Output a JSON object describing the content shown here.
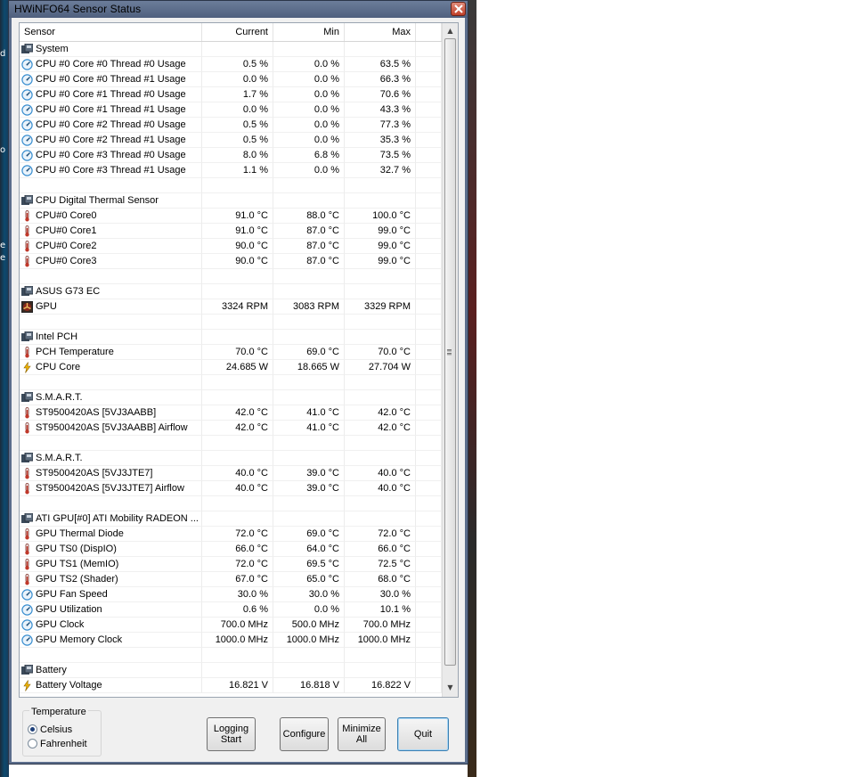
{
  "window": {
    "title": "HWiNFO64 Sensor Status"
  },
  "desktop_glyphs": [
    "d",
    "o",
    "e",
    "e"
  ],
  "columns": {
    "sensor": "Sensor",
    "current": "Current",
    "min": "Min",
    "max": "Max"
  },
  "rows": [
    {
      "kind": "group",
      "name": "System"
    },
    {
      "kind": "sensor",
      "icon": "gauge",
      "name": "CPU #0 Core #0 Thread #0 Usage",
      "current": "0.5 %",
      "min": "0.0 %",
      "max": "63.5 %"
    },
    {
      "kind": "sensor",
      "icon": "gauge",
      "name": "CPU #0 Core #0 Thread #1 Usage",
      "current": "0.0 %",
      "min": "0.0 %",
      "max": "66.3 %"
    },
    {
      "kind": "sensor",
      "icon": "gauge",
      "name": "CPU #0 Core #1 Thread #0 Usage",
      "current": "1.7 %",
      "min": "0.0 %",
      "max": "70.6 %"
    },
    {
      "kind": "sensor",
      "icon": "gauge",
      "name": "CPU #0 Core #1 Thread #1 Usage",
      "current": "0.0 %",
      "min": "0.0 %",
      "max": "43.3 %"
    },
    {
      "kind": "sensor",
      "icon": "gauge",
      "name": "CPU #0 Core #2 Thread #0 Usage",
      "current": "0.5 %",
      "min": "0.0 %",
      "max": "77.3 %"
    },
    {
      "kind": "sensor",
      "icon": "gauge",
      "name": "CPU #0 Core #2 Thread #1 Usage",
      "current": "0.5 %",
      "min": "0.0 %",
      "max": "35.3 %"
    },
    {
      "kind": "sensor",
      "icon": "gauge",
      "name": "CPU #0 Core #3 Thread #0 Usage",
      "current": "8.0 %",
      "min": "6.8 %",
      "max": "73.5 %"
    },
    {
      "kind": "sensor",
      "icon": "gauge",
      "name": "CPU #0 Core #3 Thread #1 Usage",
      "current": "1.1 %",
      "min": "0.0 %",
      "max": "32.7 %"
    },
    {
      "kind": "blank"
    },
    {
      "kind": "group",
      "name": "CPU Digital Thermal Sensor"
    },
    {
      "kind": "sensor",
      "icon": "thermometer",
      "name": "CPU#0 Core0",
      "current": "91.0 °C",
      "min": "88.0 °C",
      "max": "100.0 °C"
    },
    {
      "kind": "sensor",
      "icon": "thermometer",
      "name": "CPU#0 Core1",
      "current": "91.0 °C",
      "min": "87.0 °C",
      "max": "99.0 °C"
    },
    {
      "kind": "sensor",
      "icon": "thermometer",
      "name": "CPU#0 Core2",
      "current": "90.0 °C",
      "min": "87.0 °C",
      "max": "99.0 °C"
    },
    {
      "kind": "sensor",
      "icon": "thermometer",
      "name": "CPU#0 Core3",
      "current": "90.0 °C",
      "min": "87.0 °C",
      "max": "99.0 °C"
    },
    {
      "kind": "blank"
    },
    {
      "kind": "group",
      "name": "ASUS G73 EC"
    },
    {
      "kind": "sensor",
      "icon": "fan",
      "name": "GPU",
      "current": "3324 RPM",
      "min": "3083 RPM",
      "max": "3329 RPM"
    },
    {
      "kind": "blank"
    },
    {
      "kind": "group",
      "name": "Intel PCH"
    },
    {
      "kind": "sensor",
      "icon": "thermometer",
      "name": "PCH Temperature",
      "current": "70.0 °C",
      "min": "69.0 °C",
      "max": "70.0 °C"
    },
    {
      "kind": "sensor",
      "icon": "bolt",
      "name": "CPU Core",
      "current": "24.685 W",
      "min": "18.665 W",
      "max": "27.704 W"
    },
    {
      "kind": "blank"
    },
    {
      "kind": "group",
      "name": "S.M.A.R.T."
    },
    {
      "kind": "sensor",
      "icon": "thermometer",
      "name": "ST9500420AS [5VJ3AABB]",
      "current": "42.0 °C",
      "min": "41.0 °C",
      "max": "42.0 °C"
    },
    {
      "kind": "sensor",
      "icon": "thermometer",
      "name": "ST9500420AS [5VJ3AABB] Airflow",
      "current": "42.0 °C",
      "min": "41.0 °C",
      "max": "42.0 °C"
    },
    {
      "kind": "blank"
    },
    {
      "kind": "group",
      "name": "S.M.A.R.T."
    },
    {
      "kind": "sensor",
      "icon": "thermometer",
      "name": "ST9500420AS [5VJ3JTE7]",
      "current": "40.0 °C",
      "min": "39.0 °C",
      "max": "40.0 °C"
    },
    {
      "kind": "sensor",
      "icon": "thermometer",
      "name": "ST9500420AS [5VJ3JTE7] Airflow",
      "current": "40.0 °C",
      "min": "39.0 °C",
      "max": "40.0 °C"
    },
    {
      "kind": "blank"
    },
    {
      "kind": "group",
      "name": "ATI GPU[#0] ATI Mobility RADEON ..."
    },
    {
      "kind": "sensor",
      "icon": "thermometer",
      "name": "GPU Thermal Diode",
      "current": "72.0 °C",
      "min": "69.0 °C",
      "max": "72.0 °C"
    },
    {
      "kind": "sensor",
      "icon": "thermometer",
      "name": "GPU TS0 (DispIO)",
      "current": "66.0 °C",
      "min": "64.0 °C",
      "max": "66.0 °C"
    },
    {
      "kind": "sensor",
      "icon": "thermometer",
      "name": "GPU TS1 (MemIO)",
      "current": "72.0 °C",
      "min": "69.5 °C",
      "max": "72.5 °C"
    },
    {
      "kind": "sensor",
      "icon": "thermometer",
      "name": "GPU TS2 (Shader)",
      "current": "67.0 °C",
      "min": "65.0 °C",
      "max": "68.0 °C"
    },
    {
      "kind": "sensor",
      "icon": "gauge",
      "name": "GPU Fan Speed",
      "current": "30.0 %",
      "min": "30.0 %",
      "max": "30.0 %"
    },
    {
      "kind": "sensor",
      "icon": "gauge",
      "name": "GPU Utilization",
      "current": "0.6 %",
      "min": "0.0 %",
      "max": "10.1 %"
    },
    {
      "kind": "sensor",
      "icon": "gauge",
      "name": "GPU Clock",
      "current": "700.0 MHz",
      "min": "500.0 MHz",
      "max": "700.0 MHz"
    },
    {
      "kind": "sensor",
      "icon": "gauge",
      "name": "GPU Memory Clock",
      "current": "1000.0 MHz",
      "min": "1000.0 MHz",
      "max": "1000.0 MHz"
    },
    {
      "kind": "blank"
    },
    {
      "kind": "group",
      "name": "Battery"
    },
    {
      "kind": "sensor",
      "icon": "bolt",
      "name": "Battery Voltage",
      "current": "16.821 V",
      "min": "16.818 V",
      "max": "16.822 V"
    }
  ],
  "temperature": {
    "title": "Temperature",
    "options": [
      "Celsius",
      "Fahrenheit"
    ],
    "selected": "Celsius"
  },
  "buttons": {
    "logging": "Logging\nStart",
    "configure": "Configure",
    "minimize": "Minimize\nAll",
    "quit": "Quit"
  },
  "colors": {
    "titlebar": "#5c6e8c",
    "thermometer": "#c0392b",
    "bolt": "#f0b400",
    "gauge": "#3a8fd0"
  }
}
